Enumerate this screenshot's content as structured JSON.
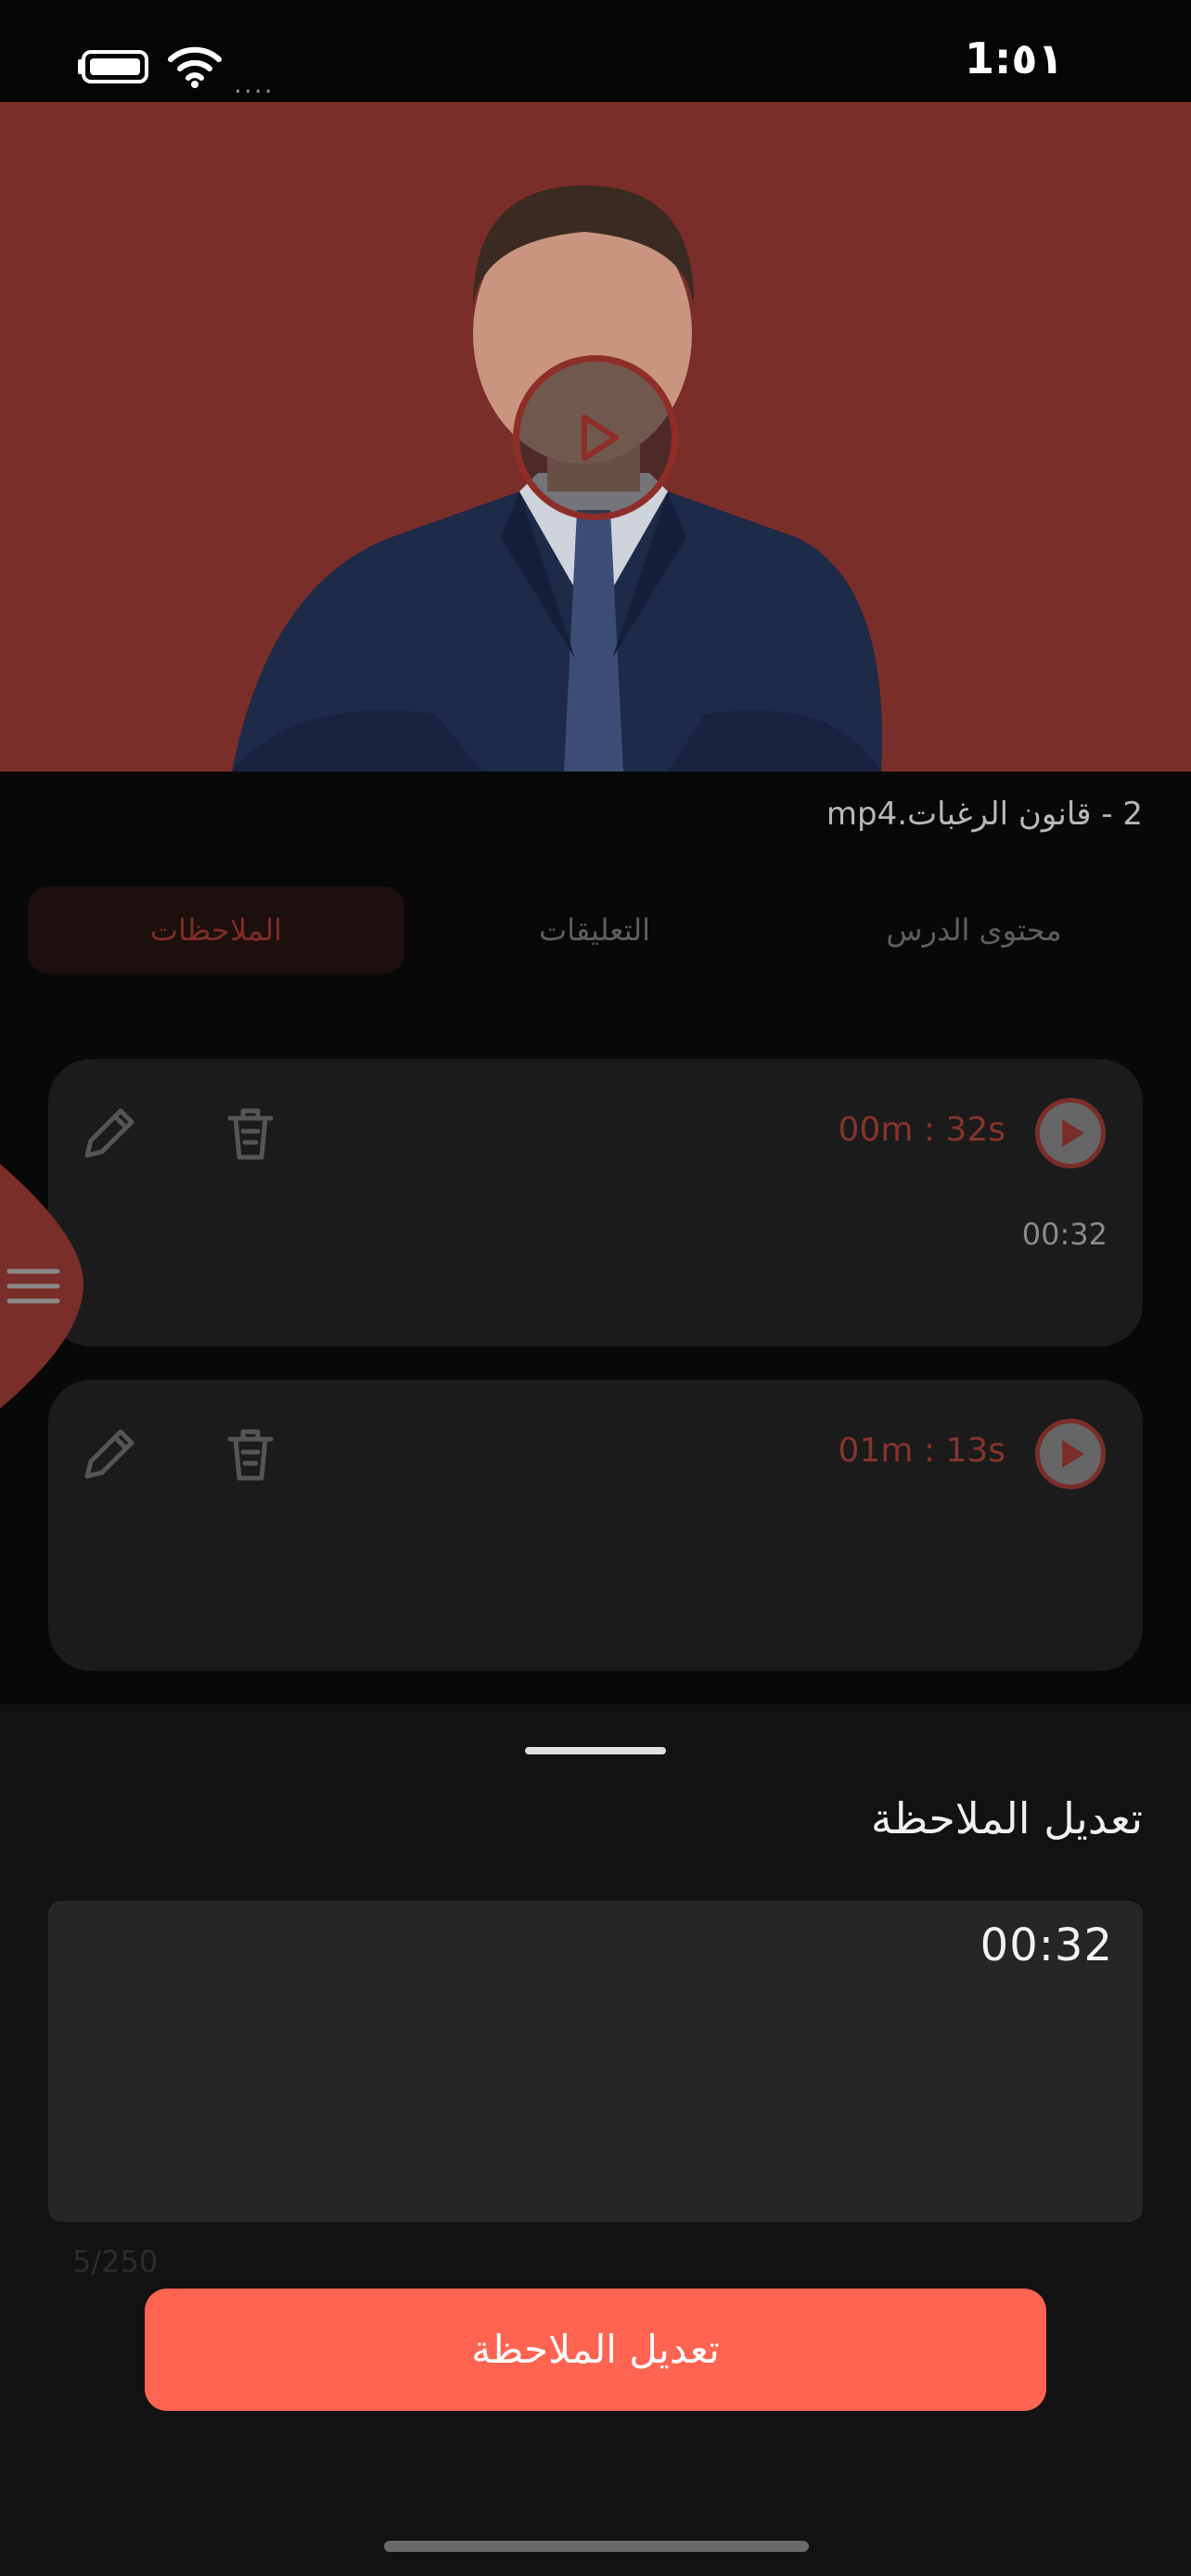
{
  "status_bar": {
    "time": "1:٥١",
    "signal_dots": "....",
    "icons": [
      "battery-icon",
      "wifi-icon"
    ]
  },
  "video": {
    "title": "2 - قانون الرغبات.mp4",
    "play_icon": "play-icon",
    "background_color": "#7a2e29"
  },
  "tabs": [
    {
      "label": "الملاحظات",
      "active": true
    },
    {
      "label": "التعليقات",
      "active": false
    },
    {
      "label": "محتوى الدرس",
      "active": false
    }
  ],
  "notes": [
    {
      "timestamp": "00m : 32s",
      "text": "00:32",
      "icons": [
        "play-icon",
        "trash-icon",
        "pencil-icon"
      ]
    },
    {
      "timestamp": "01m : 13s",
      "text": "",
      "icons": [
        "play-icon",
        "trash-icon",
        "pencil-icon"
      ]
    }
  ],
  "drawer": {
    "icon": "menu-icon"
  },
  "edit_sheet": {
    "title": "تعديل الملاحظة",
    "text_value": "00:32",
    "char_counter": "5/250",
    "submit_label": "تعديل الملاحظة"
  },
  "colors": {
    "accent": "#ff6351",
    "dark_red": "#7a2e29",
    "background": "#080808"
  }
}
